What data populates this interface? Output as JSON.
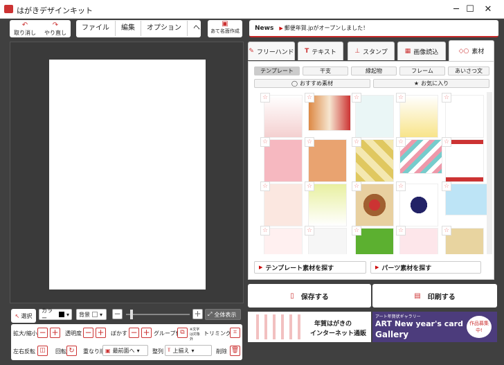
{
  "window": {
    "title": "はがきデザインキット",
    "min": "─",
    "max": "☐",
    "close": "✕"
  },
  "toolbar": {
    "undo": "取り消し",
    "redo": "やり直し",
    "menus": [
      "ファイル",
      "編集",
      "オプション",
      "ヘルプ"
    ],
    "address": "あて名面作成"
  },
  "news": {
    "label": "News",
    "text": "郵便年賀.jpがオープンしました！"
  },
  "tabs": [
    "フリーハンド",
    "テキスト",
    "スタンプ",
    "画像読込",
    "素材"
  ],
  "segments": [
    "テンプレート",
    "干支",
    "縁起物",
    "フレーム",
    "あいさつ文"
  ],
  "segments2": [
    "おすすめ素材",
    "お気に入り"
  ],
  "find": {
    "template": "テンプレート素材を探す",
    "parts": "パーツ素材を探す"
  },
  "actions": {
    "save": "保存する",
    "print": "印刷する"
  },
  "banner": {
    "left1": "年賀はがきの",
    "left2": "インターネット通販",
    "right_small": "アート年賀状ギャラリー",
    "right_big1": "ART New year's card",
    "right_big2": "Gallery",
    "badge": "作品募集中!"
  },
  "bottom": {
    "select": "選択",
    "color": "カラー",
    "bg": "背景",
    "fitall": "全体表示",
    "zoom": "拡大/縮小",
    "opacity": "透明度",
    "blur": "ぼかす",
    "group": "グループ化",
    "group_note": "※文字は対象外",
    "trim": "トリミング",
    "flip": "左右反転",
    "rotate": "回転",
    "order": "重なり順",
    "front": "最前面へ",
    "align": "整列",
    "top": "上揃え",
    "delete": "削除"
  },
  "colors": {
    "accent": "#c62828",
    "dark": "#404040"
  }
}
